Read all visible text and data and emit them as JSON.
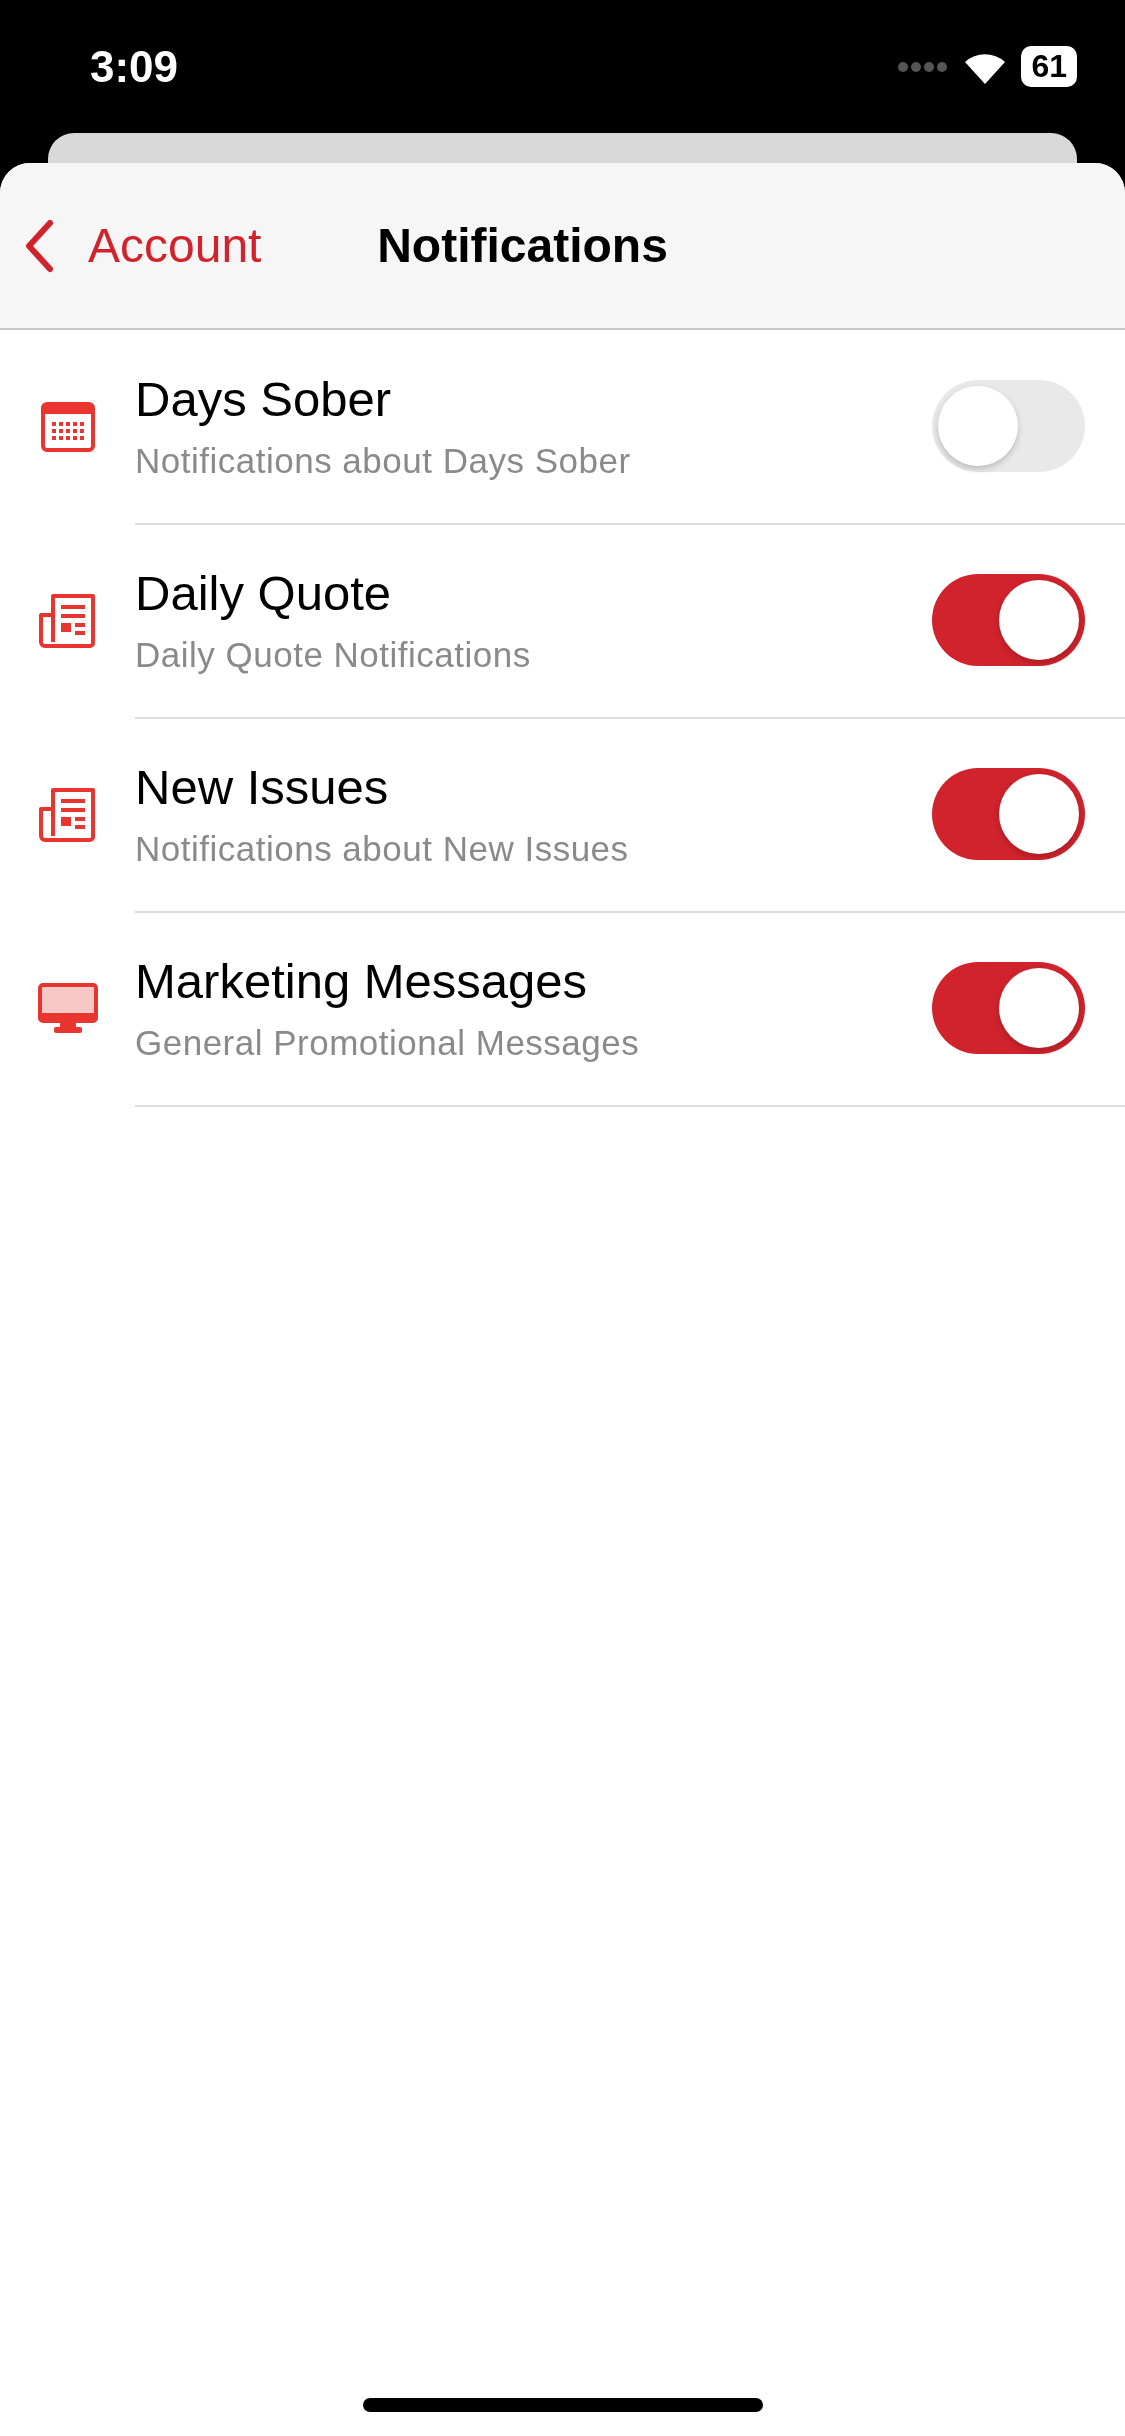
{
  "status_bar": {
    "time": "3:09",
    "battery": "61"
  },
  "nav": {
    "back": "Account",
    "title": "Notifications"
  },
  "items": [
    {
      "kind": "calendar",
      "title": "Days Sober",
      "subtitle": "Notifications about Days Sober",
      "on": false
    },
    {
      "kind": "newspaper",
      "title": "Daily Quote",
      "subtitle": "Daily Quote Notifications",
      "on": true
    },
    {
      "kind": "newspaper",
      "title": "New Issues",
      "subtitle": "Notifications about New Issues",
      "on": true
    },
    {
      "kind": "monitor",
      "title": "Marketing Messages",
      "subtitle": "General Promotional Messages",
      "on": true
    }
  ]
}
